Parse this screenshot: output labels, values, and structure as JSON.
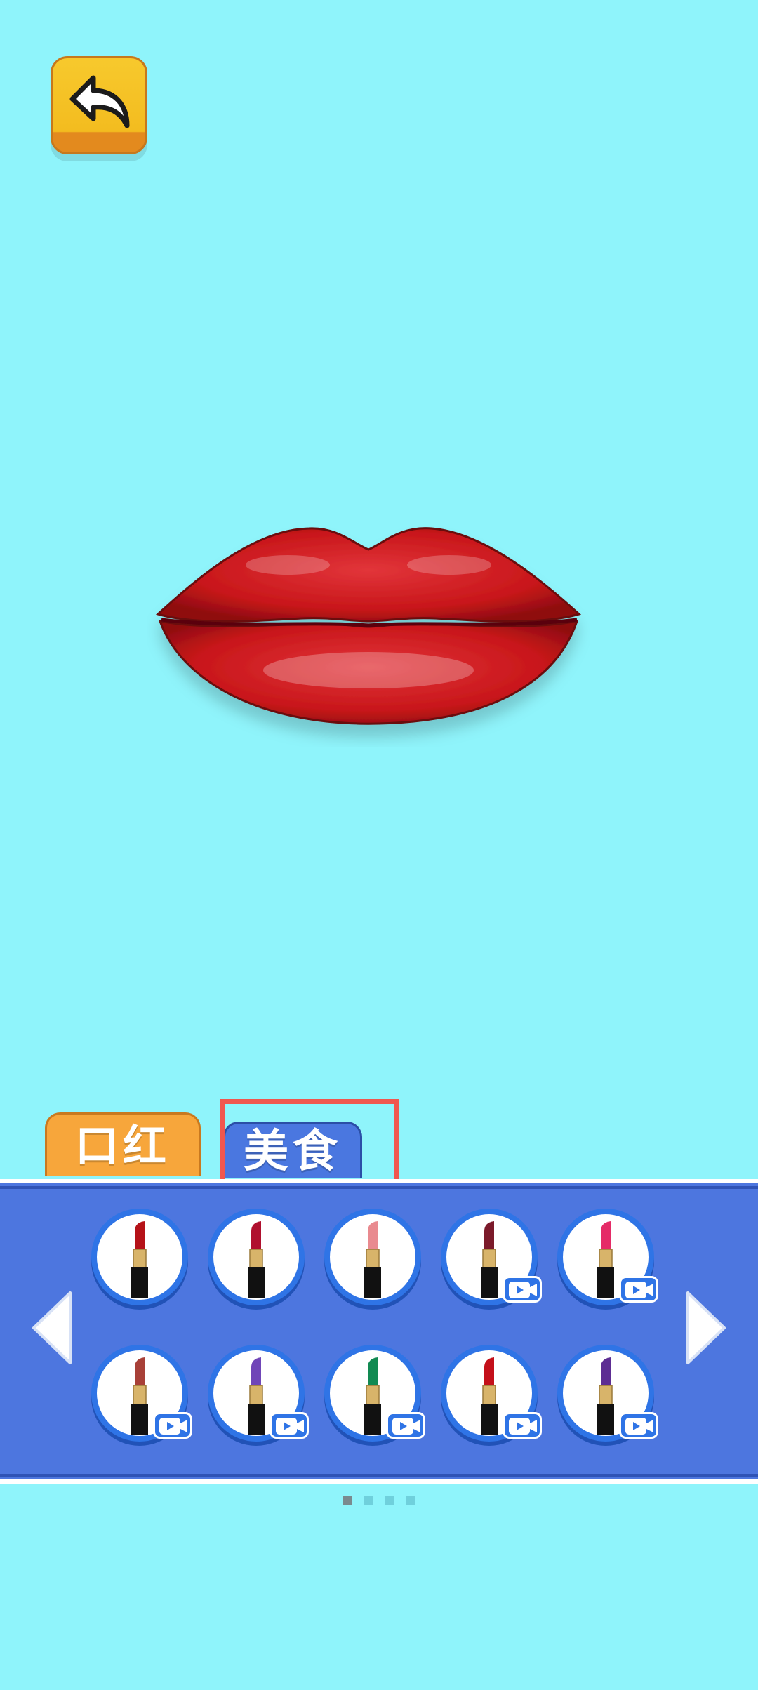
{
  "tabs": {
    "lipstick_label": "口红",
    "food_label": "美食"
  },
  "colors": {
    "background": "#8ff4fb",
    "panel": "#4d76df",
    "tab_lipstick": "#f7a63b",
    "tab_food": "#4a77e0",
    "highlight": "#f0574f",
    "lips": "#c8161a"
  },
  "icons": {
    "back": "back-arrow-icon",
    "prev": "chevron-left-icon",
    "next": "chevron-right-icon",
    "video": "video-ad-icon"
  },
  "lipsticks": [
    {
      "color": "#b51218",
      "locked": false
    },
    {
      "color": "#b0102e",
      "locked": false
    },
    {
      "color": "#e98a8f",
      "locked": false
    },
    {
      "color": "#7b1a2a",
      "locked": true
    },
    {
      "color": "#e52b67",
      "locked": true
    },
    {
      "color": "#a84038",
      "locked": true
    },
    {
      "color": "#7046b8",
      "locked": true
    },
    {
      "color": "#128a52",
      "locked": true
    },
    {
      "color": "#c4101a",
      "locked": true
    },
    {
      "color": "#5d2d93",
      "locked": true
    }
  ],
  "pagination": {
    "pages": 4,
    "current": 1
  }
}
